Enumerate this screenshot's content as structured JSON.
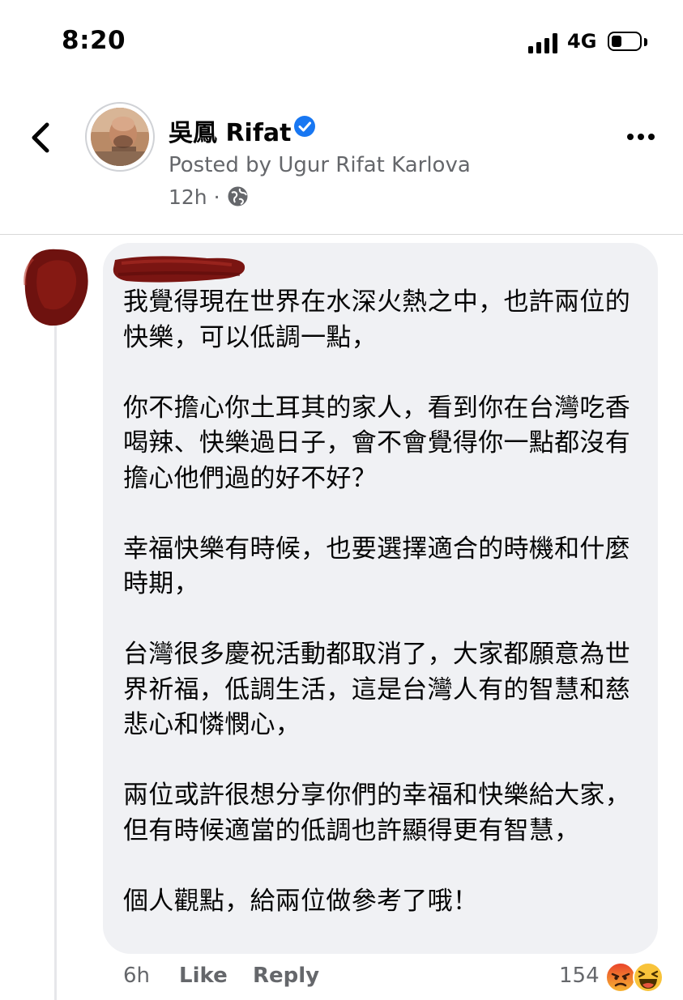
{
  "status_bar": {
    "time": "8:20",
    "network": "4G",
    "signal_bars": 4,
    "battery_level": 0.3
  },
  "post": {
    "page_name": "吳鳳 Rifat",
    "verified": true,
    "posted_by": "Posted by Ugur Rifat Karlova",
    "time": "12h ·",
    "audience_icon": "globe-icon"
  },
  "comment": {
    "paragraphs": [
      "我覺得現在世界在水深火熱之中，也許兩位的快樂，可以低調一點，",
      "你不擔心你土耳其的家人，看到你在台灣吃香喝辣、快樂過日子，會不會覺得你一點都沒有擔心他們過的好不好？",
      "幸福快樂有時候，也要選擇適合的時機和什麼時期，",
      "台灣很多慶祝活動都取消了，大家都願意為世界祈福，低調生活，這是台灣人有的智慧和慈悲心和憐憫心，",
      "兩位或許很想分享你們的幸福和快樂給大家，但有時候適當的低調也許顯得更有智慧，",
      "個人觀點，給兩位做參考了哦！"
    ],
    "age": "6h",
    "like_label": "Like",
    "reply_label": "Reply",
    "reaction_count": "154",
    "reactions": [
      "angry-reaction-icon",
      "haha-reaction-icon"
    ]
  },
  "colors": {
    "verified_blue": "#1877f2",
    "secondary_text": "#65676b",
    "bubble_bg": "#f0f1f4",
    "redaction": "#7a1512"
  }
}
